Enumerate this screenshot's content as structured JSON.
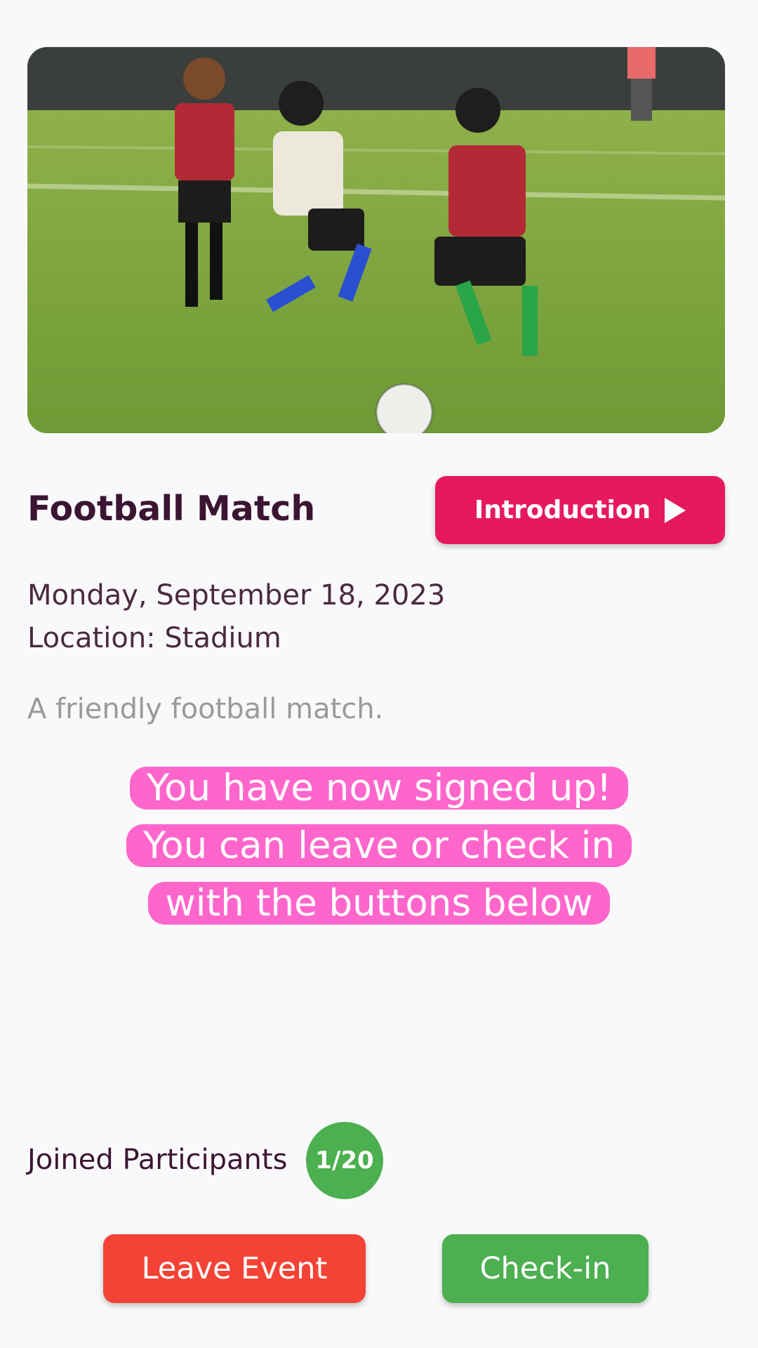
{
  "event": {
    "title": "Football Match",
    "date": "Monday, September 18, 2023",
    "location": "Location: Stadium",
    "description": "A friendly football match."
  },
  "header": {
    "intro_label": "Introduction"
  },
  "notice": {
    "line1": "You have now signed up!",
    "line2": "You can leave or check in",
    "line3": "with the buttons below"
  },
  "participants": {
    "label": "Joined Participants",
    "count": "1/20"
  },
  "actions": {
    "leave_label": "Leave Event",
    "checkin_label": "Check-in"
  },
  "colors": {
    "intro_button": "#e61960",
    "leave_button": "#f44336",
    "checkin_button": "#4caf50",
    "notice_bg": "#ff66cc",
    "title_text": "#3c1533"
  },
  "icons": {
    "intro_icon": "play-icon"
  }
}
